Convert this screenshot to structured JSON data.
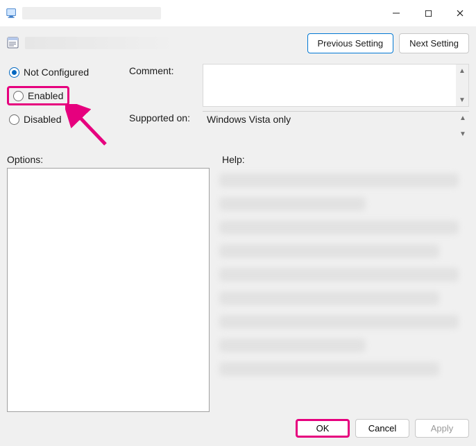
{
  "titlebar": {
    "title": ""
  },
  "header": {
    "previous_label": "Previous Setting",
    "next_label": "Next Setting"
  },
  "radios": {
    "not_configured_label": "Not Configured",
    "enabled_label": "Enabled",
    "disabled_label": "Disabled",
    "selected": "not_configured"
  },
  "fields": {
    "comment_label": "Comment:",
    "comment_value": "",
    "supported_label": "Supported on:",
    "supported_value": "Windows Vista only"
  },
  "panels": {
    "options_label": "Options:",
    "help_label": "Help:"
  },
  "buttons": {
    "ok": "OK",
    "cancel": "Cancel",
    "apply": "Apply"
  }
}
